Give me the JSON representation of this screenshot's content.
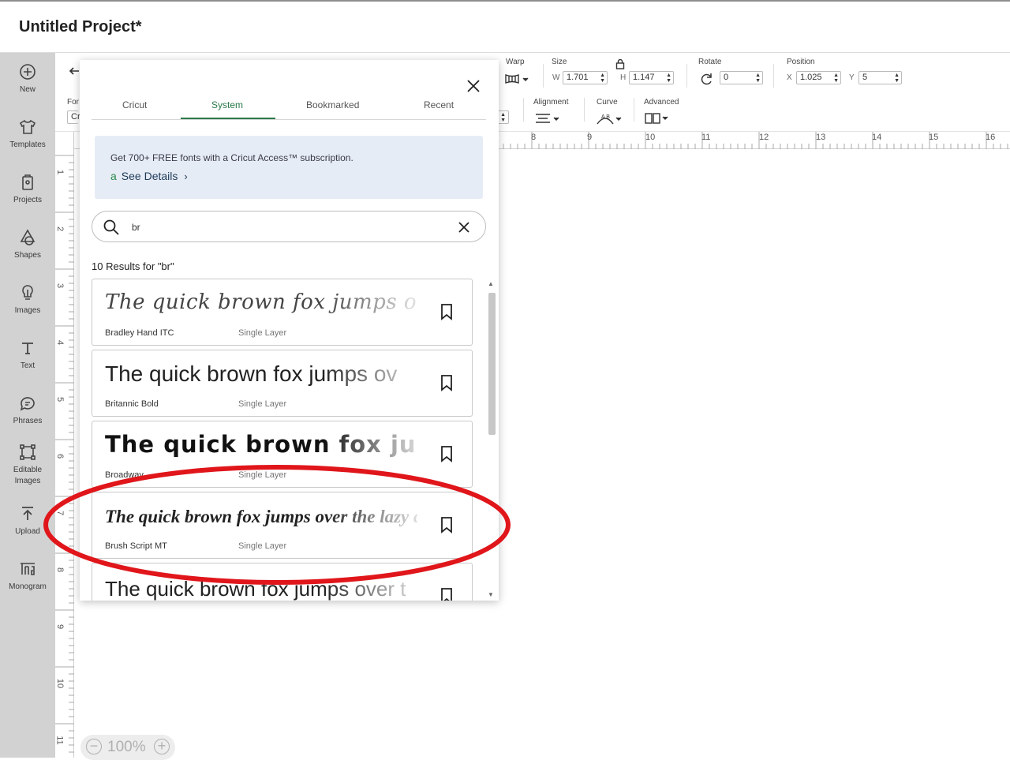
{
  "header": {
    "title": "Untitled Project*"
  },
  "sidebar": {
    "items": [
      {
        "label": "New",
        "icon": "plus-circle-icon"
      },
      {
        "label": "Templates",
        "icon": "shirt-icon"
      },
      {
        "label": "Projects",
        "icon": "clipboard-icon"
      },
      {
        "label": "Shapes",
        "icon": "shapes-icon"
      },
      {
        "label": "Images",
        "icon": "lightbulb-icon"
      },
      {
        "label": "Text",
        "icon": "text-t-icon"
      },
      {
        "label": "Phrases",
        "icon": "speech-bubble-icon"
      },
      {
        "label": "Editable",
        "label2": "Images",
        "icon": "edit-nodes-icon"
      },
      {
        "label": "Upload",
        "icon": "upload-icon"
      },
      {
        "label": "Monogram",
        "icon": "monogram-icon"
      }
    ]
  },
  "toolbar": {
    "font_label": "For",
    "font_value": "Cr",
    "warp_label": "Warp",
    "size_label": "Size",
    "w_label": "W",
    "w_value": "1.701",
    "h_label": "H",
    "h_value": "1.147",
    "rotate_label": "Rotate",
    "rotate_value": "0",
    "position_label": "Position",
    "x_label": "X",
    "x_value": "1.025",
    "y_label": "Y",
    "y_value": "5",
    "alignment_label": "Alignment",
    "curve_label": "Curve",
    "advanced_label": "Advanced"
  },
  "ruler": {
    "h_numbers": [
      "8",
      "9",
      "10",
      "11",
      "12",
      "13",
      "14",
      "15",
      "16"
    ],
    "v_numbers": [
      "1",
      "2",
      "3",
      "4",
      "5",
      "6",
      "7",
      "8",
      "9",
      "10",
      "11"
    ]
  },
  "zoom": {
    "value": "100%"
  },
  "font_panel": {
    "tabs": [
      "Cricut",
      "System",
      "Bookmarked",
      "Recent"
    ],
    "active_tab": "System",
    "promo_text": "Get 700+ FREE fonts with a Cricut Access™ subscription.",
    "promo_link": "See Details",
    "search_value": "br",
    "results_label": "10 Results for \"br\"",
    "fonts": [
      {
        "sample": "The quick brown fox jumps over",
        "name": "Bradley Hand ITC",
        "layer": "Single Layer"
      },
      {
        "sample": "The quick brown fox jumps ov",
        "name": "Britannic Bold",
        "layer": "Single Layer"
      },
      {
        "sample": "The quick brown fox jum",
        "name": "Broadway",
        "layer": "Single Layer"
      },
      {
        "sample": "The quick brown fox jumps over the lazy d",
        "name": "Brush Script MT",
        "layer": "Single Layer"
      },
      {
        "sample": "The quick brown fox jumps over t",
        "name": "",
        "layer": ""
      }
    ]
  },
  "colors": {
    "accent_green": "#2a7a4a",
    "annotation_red": "#e0161b",
    "sidebar_bg": "#d2d2d2",
    "promo_bg": "#e6ecf5"
  }
}
